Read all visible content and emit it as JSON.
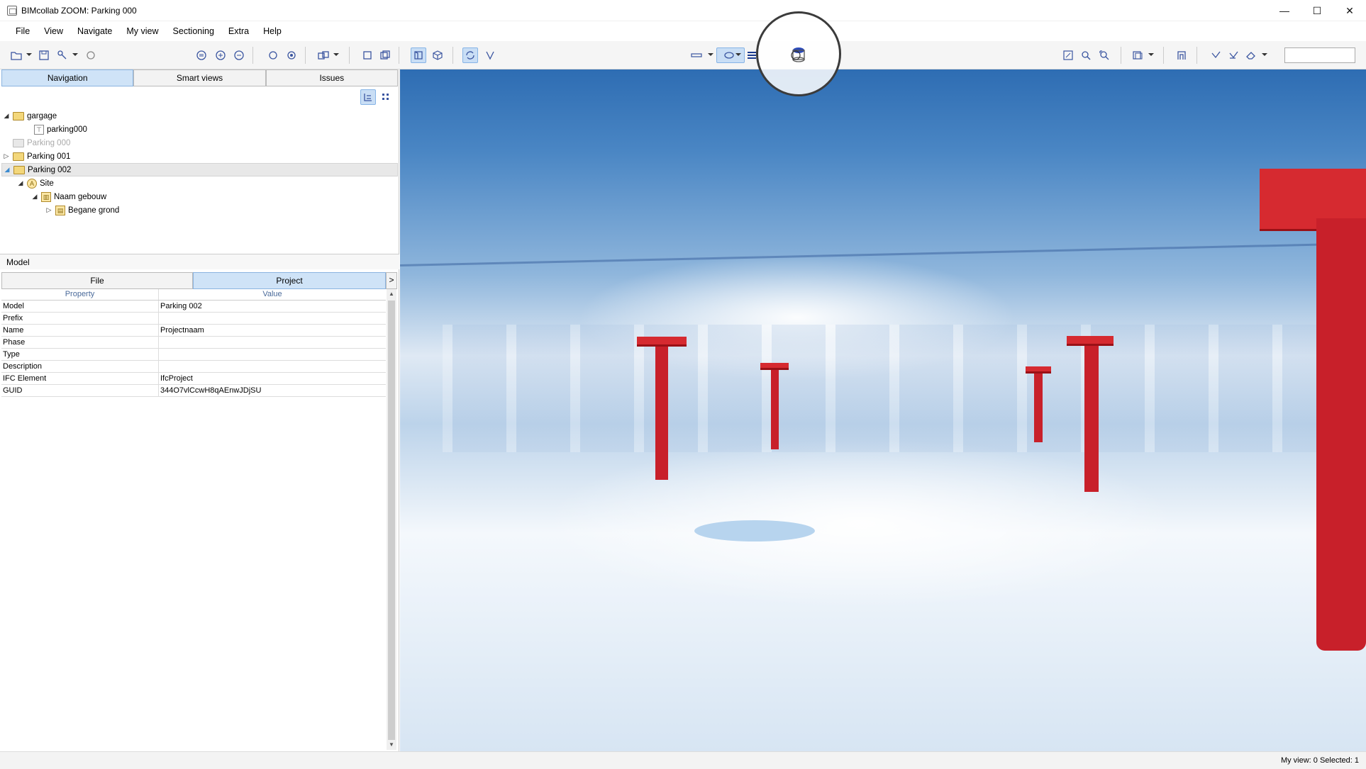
{
  "window": {
    "title": "BIMcollab ZOOM: Parking 000",
    "minimize_glyph": "—",
    "maximize_glyph": "☐",
    "close_glyph": "✕"
  },
  "menu": [
    "File",
    "View",
    "Navigate",
    "My view",
    "Sectioning",
    "Extra",
    "Help"
  ],
  "panel_tabs": [
    "Navigation",
    "Smart views",
    "Issues"
  ],
  "tree": [
    {
      "label": "gargage",
      "expander": "◢"
    },
    {
      "label": "parking000",
      "expander": ""
    },
    {
      "label": "Parking 000",
      "expander": ""
    },
    {
      "label": "Parking 001",
      "expander": "▷"
    },
    {
      "label": "Parking 002",
      "expander": "◢"
    },
    {
      "label": "Site",
      "expander": "◢"
    },
    {
      "label": "Naam gebouw",
      "expander": "◢"
    },
    {
      "label": "Begane grond",
      "expander": "▷"
    }
  ],
  "model_section": "Model",
  "prop_tabs": [
    "File",
    "Project"
  ],
  "prop_tab_arrow": ">",
  "prop_headers": [
    "Property",
    "Value"
  ],
  "properties": [
    {
      "key": "Model",
      "value": "Parking 002"
    },
    {
      "key": "Prefix",
      "value": ""
    },
    {
      "key": "Name",
      "value": "Projectnaam"
    },
    {
      "key": "Phase",
      "value": ""
    },
    {
      "key": "Type",
      "value": ""
    },
    {
      "key": "Description",
      "value": ""
    },
    {
      "key": "IFC Element",
      "value": "IfcProject"
    },
    {
      "key": "GUID",
      "value": "344O7vlCcwH8qAEnwJDjSU"
    }
  ],
  "status": "My view: 0  Selected: 1",
  "colors": {
    "accent": "#3a55a0",
    "selection": "#cfe3f7",
    "column": "#c8202a"
  }
}
